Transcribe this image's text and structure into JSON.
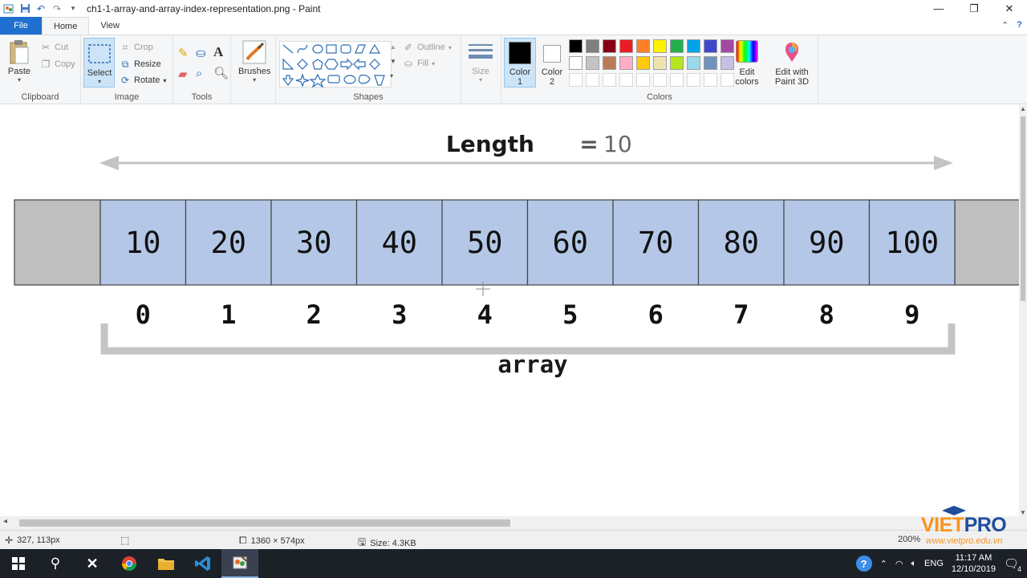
{
  "window": {
    "title": "ch1-1-array-and-array-index-representation.png - Paint",
    "minimize": "—",
    "maximize": "❐",
    "close": "✕"
  },
  "tabs": {
    "file": "File",
    "home": "Home",
    "view": "View"
  },
  "ribbon": {
    "clipboard": {
      "label": "Clipboard",
      "paste": "Paste",
      "cut": "Cut",
      "copy": "Copy"
    },
    "image": {
      "label": "Image",
      "select": "Select",
      "crop": "Crop",
      "resize": "Resize",
      "rotate": "Rotate"
    },
    "tools": {
      "label": "Tools"
    },
    "brushes": {
      "label": "Brushes"
    },
    "shapes": {
      "label": "Shapes",
      "outline": "Outline",
      "fill": "Fill"
    },
    "size": {
      "label": "Size"
    },
    "colors": {
      "label": "Colors",
      "color1": "Color 1",
      "color2": "Color 2",
      "edit_colors": "Edit colors",
      "edit_3d": "Edit with Paint 3D",
      "palette_row1": [
        "#000000",
        "#7f7f7f",
        "#880015",
        "#ed1c24",
        "#ff7f27",
        "#fff200",
        "#22b14c",
        "#00a2e8",
        "#3f48cc",
        "#a349a4"
      ],
      "palette_row2": [
        "#ffffff",
        "#c3c3c3",
        "#b97a57",
        "#ffaec9",
        "#ffc90e",
        "#efe4b0",
        "#b5e61d",
        "#99d9ea",
        "#7092be",
        "#c8bfe7"
      ]
    }
  },
  "diagram": {
    "length_label": "Length",
    "length_eq": "=",
    "length_value": "10",
    "values": [
      "10",
      "20",
      "30",
      "40",
      "50",
      "60",
      "70",
      "80",
      "90",
      "100"
    ],
    "indices": [
      "0",
      "1",
      "2",
      "3",
      "4",
      "5",
      "6",
      "7",
      "8",
      "9"
    ],
    "array_label": "array",
    "cell_color": "#b4c7e7",
    "edge_color": "#bfbfbf"
  },
  "status": {
    "cursor_pos": "327, 113px",
    "image_dims": "1360 × 574px",
    "file_size": "Size: 4.3KB",
    "zoom": "200%"
  },
  "taskbar": {
    "time": "11:17 AM",
    "date": "12/10/2019",
    "lang": "ENG",
    "notif_count": "4"
  },
  "watermark": {
    "brand_a": "VIET",
    "brand_b": "PRO",
    "url": "www.vietpro.edu.vn"
  }
}
